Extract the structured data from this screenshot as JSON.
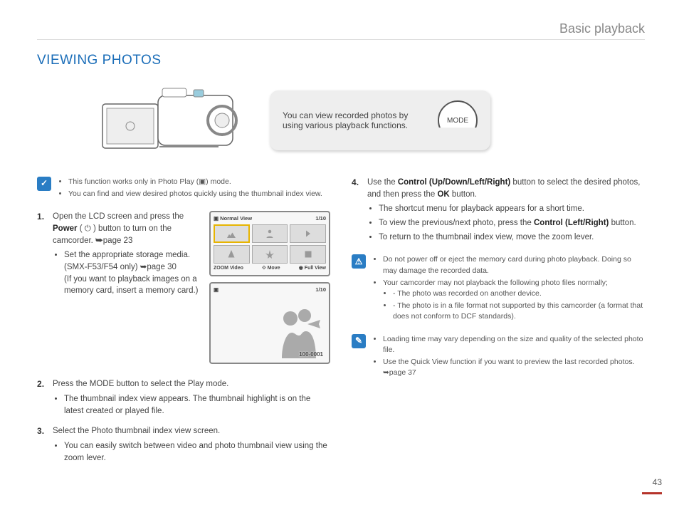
{
  "breadcrumb": "Basic playback",
  "heading": "VIEWING PHOTOS",
  "callout_text": "You can view recorded photos by using various playback functions.",
  "mode_label": "MODE",
  "check_notes": [
    "This function works only in Photo Play (▣) mode.",
    "You can find and view desired photos quickly using the thumbnail index view."
  ],
  "steps": {
    "s1": {
      "pre": "Open the LCD screen and press the ",
      "bold": "Power",
      "post": " ( ⏻ ) button to turn on the camcorder. ➥page 23"
    },
    "s1_sub": "Set the appropriate storage media. (SMX-F53/F54 only) ➥page 30\n(If you want to playback images on a memory card, insert a memory card.)",
    "s2": "Press the MODE button to select the Play mode.",
    "s2_sub": "The thumbnail index view appears. The thumbnail highlight is on the latest created or played file.",
    "s3": "Select the Photo thumbnail index view screen.",
    "s3_sub": "You can easily switch between video and photo thumbnail view using the zoom lever.",
    "s4": {
      "pre": "Use the ",
      "b1": "Control (Up/Down/Left/Right)",
      "mid": " button to select the desired photos, and then press the ",
      "b2": "OK",
      "post": " button."
    },
    "s4_sub1": "The shortcut menu for playback appears for a short time.",
    "s4_sub2": {
      "pre": "To view the previous/next photo, press the ",
      "b": "Control (Left/Right)",
      "post": " button."
    },
    "s4_sub3": "To return to the thumbnail index view, move the zoom lever."
  },
  "warn_notes": {
    "w1": "Do not power off or eject the memory card during photo playback. Doing so may damage the recorded data.",
    "w2": "Your camcorder may not playback the following photo files normally;",
    "w2a": "The photo was recorded on another device.",
    "w2b": "The photo is in a file format not supported by this camcorder (a format that does not conform to DCF standards)."
  },
  "tip_notes": {
    "t1": "Loading time may vary depending on the size and quality of the selected photo file.",
    "t2": "Use the Quick View function if you want to preview the last recorded photos. ➥page 37"
  },
  "screen1": {
    "title": "▣ Normal View",
    "counter": "1/10",
    "zoom": "ZOOM Video",
    "move": "⟐ Move",
    "full": "◉ Full View"
  },
  "screen2": {
    "counter": "1/10",
    "file": "100-0001"
  },
  "page_number": "43"
}
